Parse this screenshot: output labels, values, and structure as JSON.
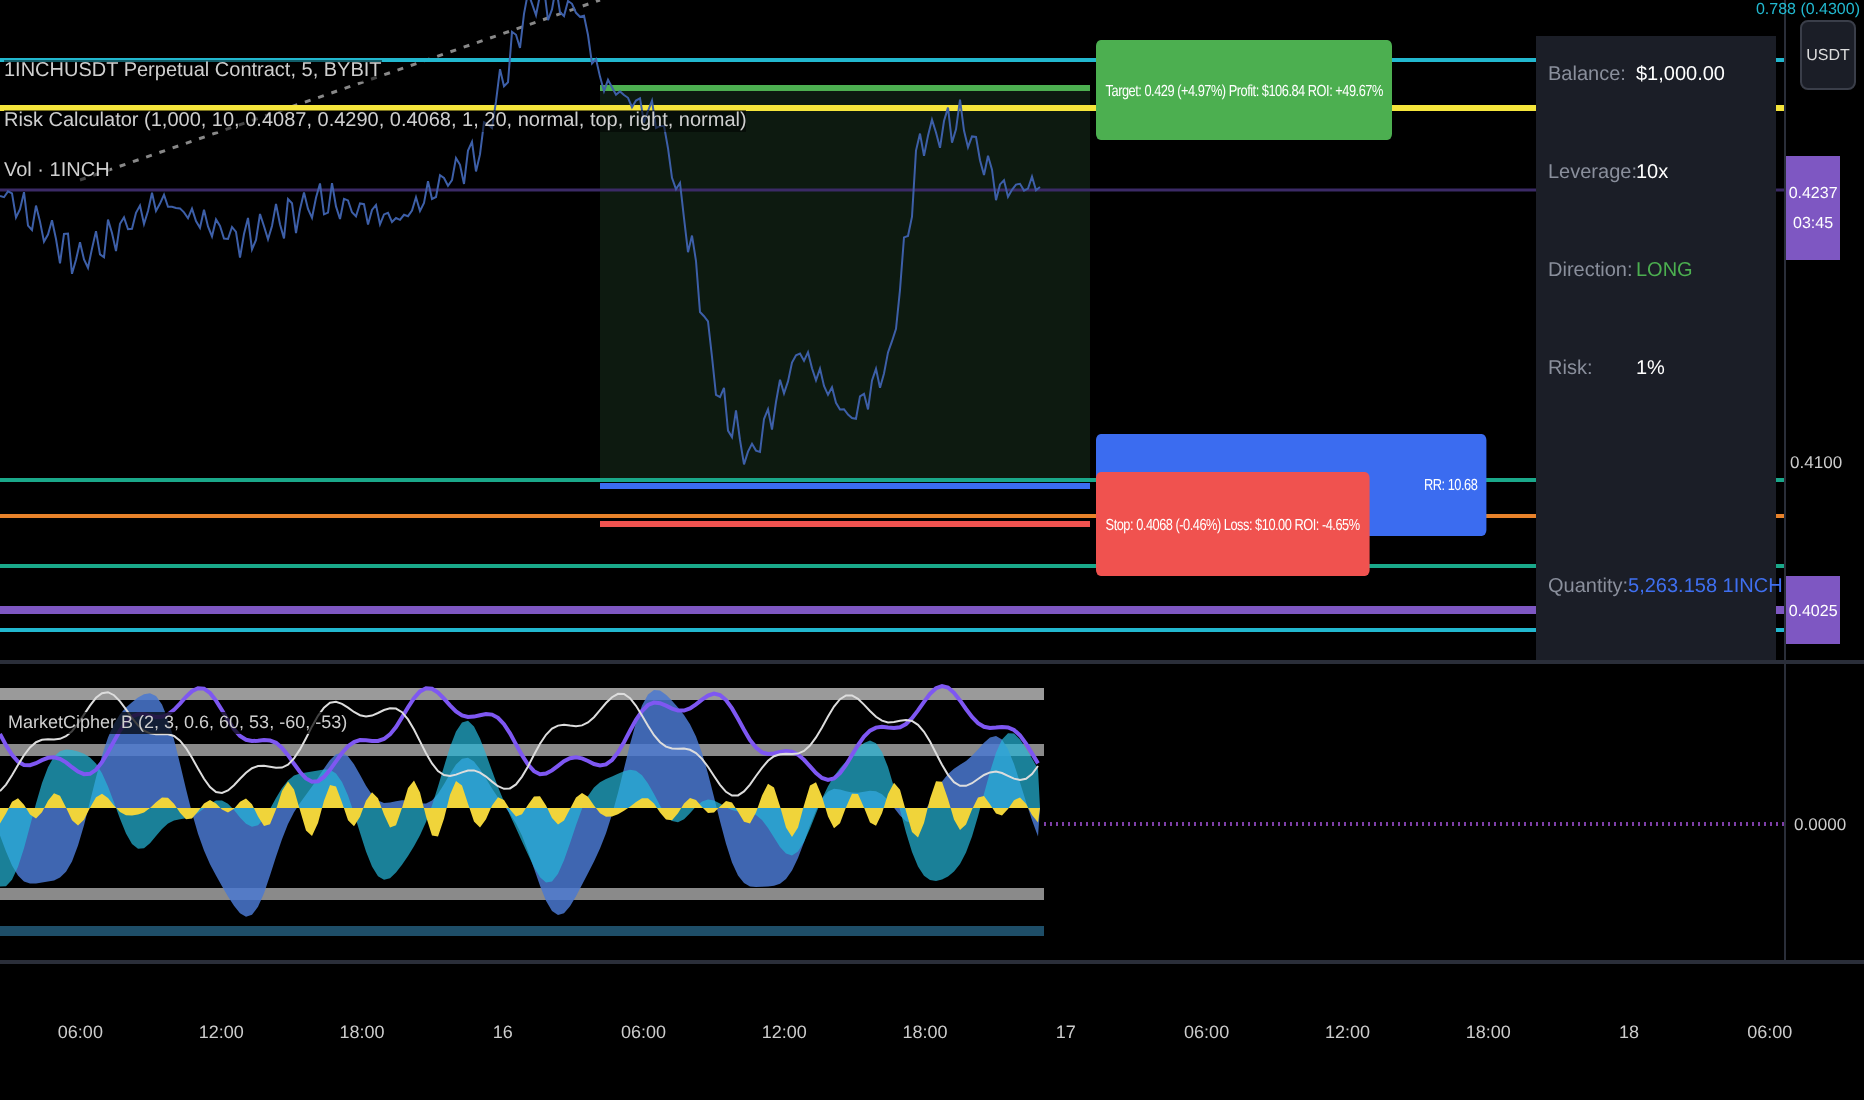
{
  "legends": [
    {
      "text": "1INCHUSDT Perpetual Contract, 5, BYBIT"
    },
    {
      "text": "Risk Calculator (1,000, 10, 0.4087, 0.4290, 0.4068, 1, 20, normal, top, right, normal)"
    },
    {
      "text": "Vol · 1INCH"
    }
  ],
  "tags": [
    {
      "kind": "target",
      "text": "Target: 0.429 (+4.97%) Profit: $106.84 ROI: +49.67%"
    },
    {
      "kind": "entry",
      "text": "RR: 10.68"
    },
    {
      "kind": "stop",
      "text": "Stop: 0.4068 (-0.46%) Loss: $10.00 ROI: -4.65%"
    }
  ],
  "risk_table": [
    {
      "label": "Balance:",
      "value": "$1,000.00",
      "color": "#ffffff"
    },
    {
      "label": "Leverage:",
      "value": "10x",
      "color": "#ffffff"
    },
    {
      "label": "Direction:",
      "value": "LONG",
      "color": "#4caf50"
    },
    {
      "label": "Risk:",
      "value": "1%",
      "color": "#ffffff"
    },
    {
      "label": "Quantity:",
      "value": "5,263.158 1INCH",
      "color": "#3f6ff0"
    }
  ],
  "price_axis": {
    "top_label": "0.788 (0.4300)",
    "unit_button": "USDT",
    "current_price": "0.4237",
    "countdown": "03:45",
    "scale_label": "0.4100",
    "marker_price": "0.4025"
  },
  "indicator": {
    "legend": "MarketCipher B (2, 3, 0.6, 60, 53, -60, -53)",
    "axis_label": "0.0000"
  },
  "time_axis": [
    "06:00",
    "12:00",
    "18:00",
    "16",
    "06:00",
    "12:00",
    "18:00",
    "17",
    "06:00",
    "12:00",
    "18:00",
    "18",
    "06:00"
  ]
}
